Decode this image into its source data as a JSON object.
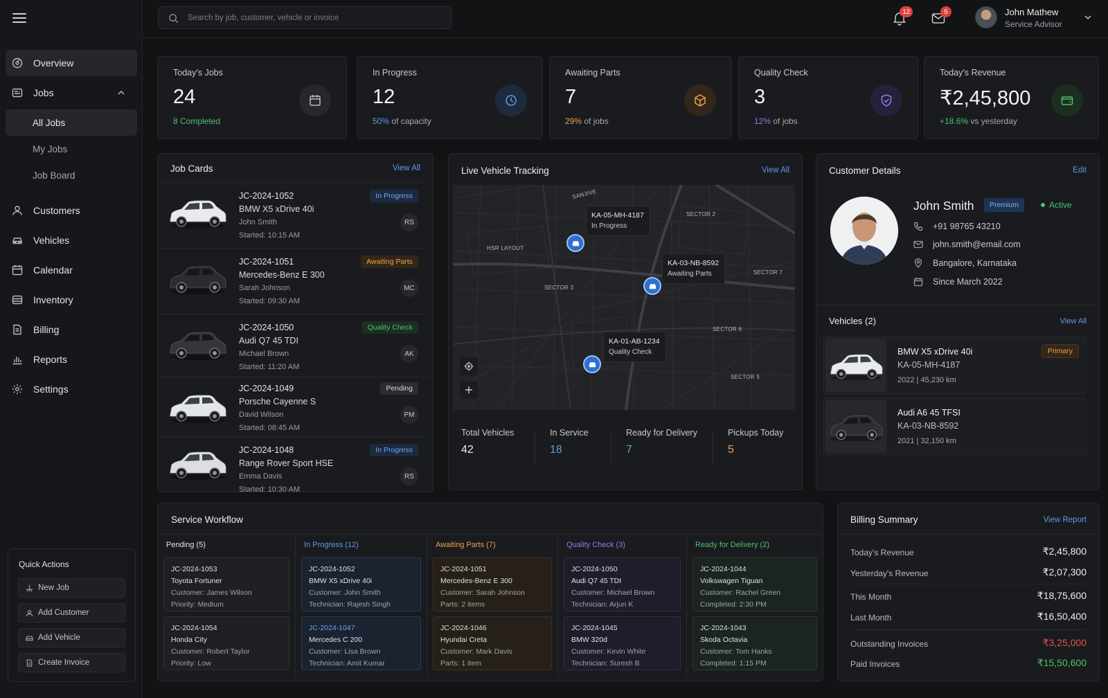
{
  "search": {
    "placeholder": "Search by job, customer, vehicle or invoice"
  },
  "topbar": {
    "notifications_count": "12",
    "messages_count": "5",
    "user_name": "John Mathew",
    "user_role": "Service Advisor"
  },
  "sidebar": {
    "items": [
      {
        "label": "Overview",
        "icon": "dashboard-icon"
      },
      {
        "label": "Jobs",
        "icon": "wrench-icon"
      },
      {
        "label": "Customers",
        "icon": "user-icon"
      },
      {
        "label": "Vehicles",
        "icon": "car-icon"
      },
      {
        "label": "Calendar",
        "icon": "calendar-icon"
      },
      {
        "label": "Inventory",
        "icon": "box-icon"
      },
      {
        "label": "Billing",
        "icon": "invoice-icon"
      },
      {
        "label": "Reports",
        "icon": "bar-chart-icon"
      },
      {
        "label": "Settings",
        "icon": "gear-icon"
      }
    ],
    "jobs_sub": [
      "All Jobs",
      "My Jobs",
      "Job Board"
    ],
    "quick_actions": {
      "title": "Quick Actions",
      "buttons": [
        "New Job",
        "Add Customer",
        "Add Vehicle",
        "Create Invoice"
      ]
    }
  },
  "stats": [
    {
      "label": "Today's Jobs",
      "value": "24",
      "sub_highlight": "8 Completed",
      "sub_rest": "",
      "accent": "#4cc36d",
      "icon": "calendar-icon"
    },
    {
      "label": "In Progress",
      "value": "12",
      "sub_highlight": "50%",
      "sub_rest": " of capacity",
      "accent": "#5f9be6",
      "icon": "clock-icon"
    },
    {
      "label": "Awaiting Parts",
      "value": "7",
      "sub_highlight": "29%",
      "sub_rest": " of jobs",
      "accent": "#f0a04b",
      "icon": "box-icon"
    },
    {
      "label": "Quality Check",
      "value": "3",
      "sub_highlight": "12%",
      "sub_rest": " of jobs",
      "accent": "#8f7cf0",
      "icon": "shield-check-icon"
    },
    {
      "label": "Today's Revenue",
      "value": "₹2,45,800",
      "sub_highlight": "+18.6%",
      "sub_rest": " vs yesterday",
      "accent": "#4cc36d",
      "icon": "wallet-icon"
    }
  ],
  "job_cards": {
    "title": "Job Cards",
    "link": "View All",
    "items": [
      {
        "id": "JC-2024-1052",
        "model": "BMW X5 xDrive 40i",
        "customer": "John Smith",
        "started": "Started: 10:15 AM",
        "status": "In Progress",
        "initials": "RS",
        "car_color": "#e9eaec"
      },
      {
        "id": "JC-2024-1051",
        "model": "Mercedes-Benz E 300",
        "customer": "Sarah Johnson",
        "started": "Started: 09:30 AM",
        "status": "Awaiting Parts",
        "initials": "MC",
        "car_color": "#2b2c30"
      },
      {
        "id": "JC-2024-1050",
        "model": "Audi Q7 45 TDI",
        "customer": "Michael Brown",
        "started": "Started: 11:20 AM",
        "status": "Quality Check",
        "initials": "AK",
        "car_color": "#34363b"
      },
      {
        "id": "JC-2024-1049",
        "model": "Porsche Cayenne S",
        "customer": "David Wilson",
        "started": "Started: 08:45 AM",
        "status": "Pending",
        "initials": "PM",
        "car_color": "#e4e5e8"
      },
      {
        "id": "JC-2024-1048",
        "model": "Range Rover Sport HSE",
        "customer": "Emma Davis",
        "started": "Started: 10:30 AM",
        "status": "In Progress",
        "initials": "RS",
        "car_color": "#dcdde0"
      }
    ]
  },
  "tracking": {
    "title": "Live Vehicle Tracking",
    "link": "View All",
    "areas": [
      "SANJIVE",
      "HSR LAYOUT",
      "SECTOR 2",
      "SECTOR 3",
      "SECTOR 7",
      "SECTOR 6",
      "SECTOR 5"
    ],
    "vehicles": [
      {
        "plate": "KA-05-MH-4187",
        "status": "In Progress"
      },
      {
        "plate": "KA-03-NB-8592",
        "status": "Awaiting Parts"
      },
      {
        "plate": "KA-01-AB-1234",
        "status": "Quality Check"
      }
    ],
    "stats": [
      {
        "label": "Total Vehicles",
        "value": "42",
        "color": "#eceef1"
      },
      {
        "label": "In Service",
        "value": "18",
        "color": "#5f9be6"
      },
      {
        "label": "Ready for Delivery",
        "value": "7",
        "color": "#4cc36d"
      },
      {
        "label": "Pickups Today",
        "value": "5",
        "color": "#f0a04b"
      }
    ]
  },
  "customer": {
    "title": "Customer Details",
    "link": "Edit",
    "name": "John Smith",
    "tier": "Premium",
    "status": "Active",
    "phone": "+91 98765 43210",
    "email": "john.smith@email.com",
    "location": "Bangalore, Karnataka",
    "since": "Since March 2022",
    "vehicles_title": "Vehicles (2)",
    "vehicles_link": "View All",
    "vehicles": [
      {
        "name": "BMW X5 xDrive 40i",
        "plate": "KA-05-MH-4187",
        "meta": "2022 | 45,230 km",
        "tag": "Primary",
        "car_color": "#e9eaec"
      },
      {
        "name": "Audi A6 45 TFSI",
        "plate": "KA-03-NB-8592",
        "meta": "2021 | 32,150 km",
        "tag": "",
        "car_color": "#2e2f33"
      }
    ]
  },
  "workflow": {
    "title": "Service Workflow",
    "columns": [
      {
        "title": "Pending (5)",
        "color": "#e6e7ea",
        "bg": "#1f2024",
        "border": "#2d2f34",
        "cards": [
          [
            "JC-2024-1053",
            "Toyota Fortuner",
            "Customer: James Wilson",
            "Priority: Medium"
          ],
          [
            "JC-2024-1054",
            "Honda City",
            "Customer: Robert Taylor",
            "Priority: Low"
          ]
        ]
      },
      {
        "title": "In Progress (12)",
        "color": "#5f9be6",
        "bg": "#1b2230",
        "border": "#2a3a55",
        "cards": [
          [
            "JC-2024-1052",
            "BMW X5 xDrive 40i",
            "Customer: John Smith",
            "Technician: Rajesh Singh"
          ],
          [
            "JC-2024-1047",
            "Mercedes C 200",
            "Customer: Lisa Brown",
            "Technician: Amit Kumar"
          ]
        ]
      },
      {
        "title": "Awaiting Parts (7)",
        "color": "#f0a04b",
        "bg": "#262019",
        "border": "#3d3124",
        "cards": [
          [
            "JC-2024-1051",
            "Mercedes-Benz E 300",
            "Customer: Sarah Johnson",
            "Parts: 2 items"
          ],
          [
            "JC-2024-1046",
            "Hyundai Creta",
            "Customer: Mark Davis",
            "Parts: 1 item"
          ]
        ]
      },
      {
        "title": "Quality Check (3)",
        "color": "#8f7cf0",
        "bg": "#1f1d2b",
        "border": "#312d47",
        "cards": [
          [
            "JC-2024-1050",
            "Audi Q7 45 TDI",
            "Customer: Michael Brown",
            "Technician: Arjun K"
          ],
          [
            "JC-2024-1045",
            "BMW 320d",
            "Customer: Kevin White",
            "Technician: Suresh B"
          ]
        ]
      },
      {
        "title": "Ready for Delivery (2)",
        "color": "#4cc36d",
        "bg": "#1b241e",
        "border": "#2a3d30",
        "cards": [
          [
            "JC-2024-1044",
            "Volkswagen Tiguan",
            "Customer: Rachel Green",
            "Completed: 2:30 PM"
          ],
          [
            "JC-2024-1043",
            "Skoda Octavia",
            "Customer: Tom Hanks",
            "Completed: 1:15 PM"
          ]
        ]
      }
    ]
  },
  "billing": {
    "title": "Billing Summary",
    "link": "View Report",
    "rows": [
      {
        "label": "Today's Revenue",
        "value": "₹2,45,800",
        "color": "#eceef1"
      },
      {
        "label": "Yesterday's Revenue",
        "value": "₹2,07,300",
        "color": "#eceef1"
      },
      {
        "label": "This Month",
        "value": "₹18,75,600",
        "color": "#eceef1"
      },
      {
        "label": "Last Month",
        "value": "₹16,50,400",
        "color": "#eceef1"
      },
      {
        "label": "Outstanding Invoices",
        "value": "₹3,25,000",
        "color": "#e5534b"
      },
      {
        "label": "Paid Invoices",
        "value": "₹15,50,600",
        "color": "#4cc36d"
      }
    ]
  },
  "status_colors": {
    "In Progress": {
      "fg": "#6ea6ec",
      "bg": "#1c2a40"
    },
    "Awaiting Parts": {
      "fg": "#f0a04b",
      "bg": "#33261a"
    },
    "Quality Check": {
      "fg": "#4cc36d",
      "bg": "#1c2e22"
    },
    "Pending": {
      "fg": "#d6d8dc",
      "bg": "#2a2c30"
    }
  }
}
